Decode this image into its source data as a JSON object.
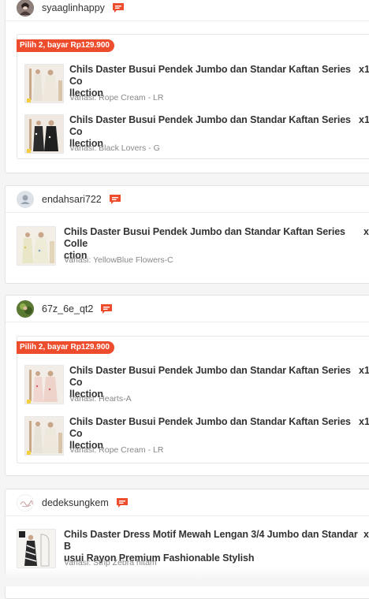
{
  "accent_color": "#ee4d2d",
  "orders": [
    {
      "username": "syaaglinhappy",
      "avatar_icon": "user-photo-avatar",
      "chat_icon": "chat-bubble-icon",
      "bundle_label": "Pilih 2, bayar Rp129.900",
      "items": [
        {
          "title_line1": "Chils Daster Busui Pendek Jumbo dan Standar Kaftan Series Co",
          "title_line2": "llection",
          "qty": "x1",
          "variant": "Variasi: Rope Cream - LR"
        },
        {
          "title_line1": "Chils Daster Busui Pendek Jumbo dan Standar Kaftan Series Co",
          "title_line2": "llection",
          "qty": "x1",
          "variant": "Variasi: Black Lovers - G"
        }
      ]
    },
    {
      "username": "endahsari722",
      "avatar_icon": "default-user-avatar",
      "chat_icon": "chat-bubble-icon",
      "items": [
        {
          "title_line1": "Chils Daster Busui Pendek Jumbo dan Standar Kaftan Series Colle",
          "title_line2": "ction",
          "qty": "x",
          "variant": "Variasi: YellowBlue Flowers-C"
        }
      ]
    },
    {
      "username": "67z_6e_qt2",
      "avatar_icon": "user-photo-avatar",
      "chat_icon": "chat-bubble-icon",
      "bundle_label": "Pilih 2, bayar Rp129.900",
      "items": [
        {
          "title_line1": "Chils Daster Busui Pendek Jumbo dan Standar Kaftan Series Co",
          "title_line2": "llection",
          "qty": "x1",
          "variant": "Variasi: Hearts-A"
        },
        {
          "title_line1": "Chils Daster Busui Pendek Jumbo dan Standar Kaftan Series Co",
          "title_line2": "llection",
          "qty": "x1",
          "variant": "Variasi: Rope Cream - LR"
        }
      ]
    },
    {
      "username": "dedeksungkem",
      "avatar_icon": "user-photo-avatar",
      "chat_icon": "chat-bubble-icon",
      "items": [
        {
          "title_line1": "Chils Daster Dress Motif Mewah Lengan 3/4 Jumbo dan Standar B",
          "title_line2": "usui Rayon Premium Fashionable Stylish",
          "qty": "x",
          "variant": "Variasi: Strip Zebra hitam"
        }
      ]
    }
  ]
}
